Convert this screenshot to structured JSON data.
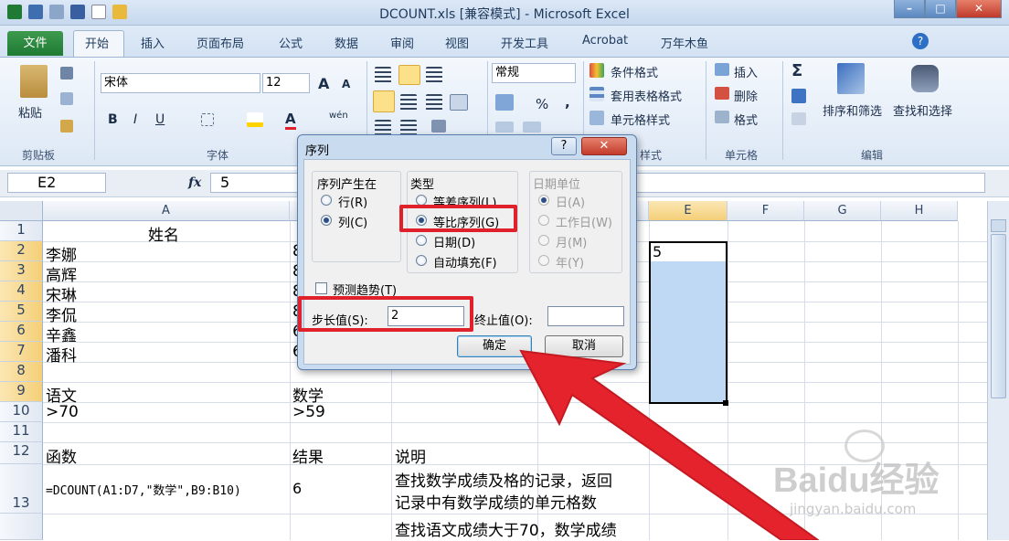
{
  "window": {
    "title": "DCOUNT.xls  [兼容模式] - Microsoft Excel"
  },
  "tabs": [
    "文件",
    "开始",
    "插入",
    "页面布局",
    "公式",
    "数据",
    "审阅",
    "视图",
    "开发工具",
    "Acrobat",
    "万年木鱼"
  ],
  "ribbon": {
    "clipboard": {
      "paste": "粘贴",
      "label": "剪贴板"
    },
    "font": {
      "name": "宋体",
      "size": "12",
      "label": "字体",
      "bold": "B",
      "italic": "I",
      "underline": "U",
      "grow": "A",
      "color_a": "A",
      "wen": "wén"
    },
    "number": {
      "format": "常规",
      "percent": "%",
      "comma": ","
    },
    "styles": {
      "cond": "条件格式",
      "table": "套用表格格式",
      "cell": "单元格样式",
      "label": "样式"
    },
    "cells": {
      "insert": "插入",
      "delete": "删除",
      "format": "格式",
      "label": "单元格"
    },
    "edit": {
      "sort": "排序和筛选",
      "find": "查找和选择",
      "label": "编辑",
      "sigma": "Σ"
    }
  },
  "formula_bar": {
    "cell_ref": "E2",
    "fx": "fx",
    "value": "5"
  },
  "columns": [
    "A",
    "B",
    "C",
    "D",
    "E",
    "F",
    "G",
    "H"
  ],
  "rows": [
    "1",
    "2",
    "3",
    "4",
    "5",
    "6",
    "7",
    "8",
    "9",
    "10",
    "11",
    "12",
    "13"
  ],
  "cells": {
    "a1": "姓名",
    "a2": "李娜",
    "a3": "高辉",
    "a4": "宋琳",
    "a5": "李侃",
    "a6": "辛鑫",
    "a7": "潘科",
    "b2": "8",
    "b3": "8",
    "b4": "8",
    "b5": "8",
    "b6": "6",
    "b7": "6",
    "a9": "语文",
    "b9": "数学",
    "a10": ">70",
    "b10": ">59",
    "a12": "函数",
    "b12": "结果",
    "c12": "说明",
    "a13": "=DCOUNT(A1:D7,\"数学\",B9:B10)",
    "b13": "6",
    "c13_1": "查找数学成绩及格的记录，返回",
    "c13_2": "记录中有数学成绩的单元格数",
    "c14": "查找语文成绩大于70，数学成绩",
    "e2": "5"
  },
  "dialog": {
    "title": "序列",
    "help": "?",
    "close": "✕",
    "series_in": {
      "label": "序列产生在",
      "options": [
        "行(R)",
        "列(C)"
      ],
      "selected": 1
    },
    "type": {
      "label": "类型",
      "options": [
        "等差序列(L)",
        "等比序列(G)",
        "日期(D)",
        "自动填充(F)"
      ],
      "selected": 1
    },
    "date_unit": {
      "label": "日期单位",
      "options": [
        "日(A)",
        "工作日(W)",
        "月(M)",
        "年(Y)"
      ],
      "selected": 0
    },
    "trend": "预测趋势(T)",
    "step_label": "步长值(S):",
    "step_value": "2",
    "stop_label": "终止值(O):",
    "stop_value": "",
    "ok": "确定",
    "cancel": "取消"
  },
  "watermark": {
    "brand": "Baidu经验",
    "url": "jingyan.baidu.com"
  },
  "colors": {
    "selection": "#bfd8f4",
    "highlight": "#e0202a",
    "arrow": "#e4232c"
  }
}
